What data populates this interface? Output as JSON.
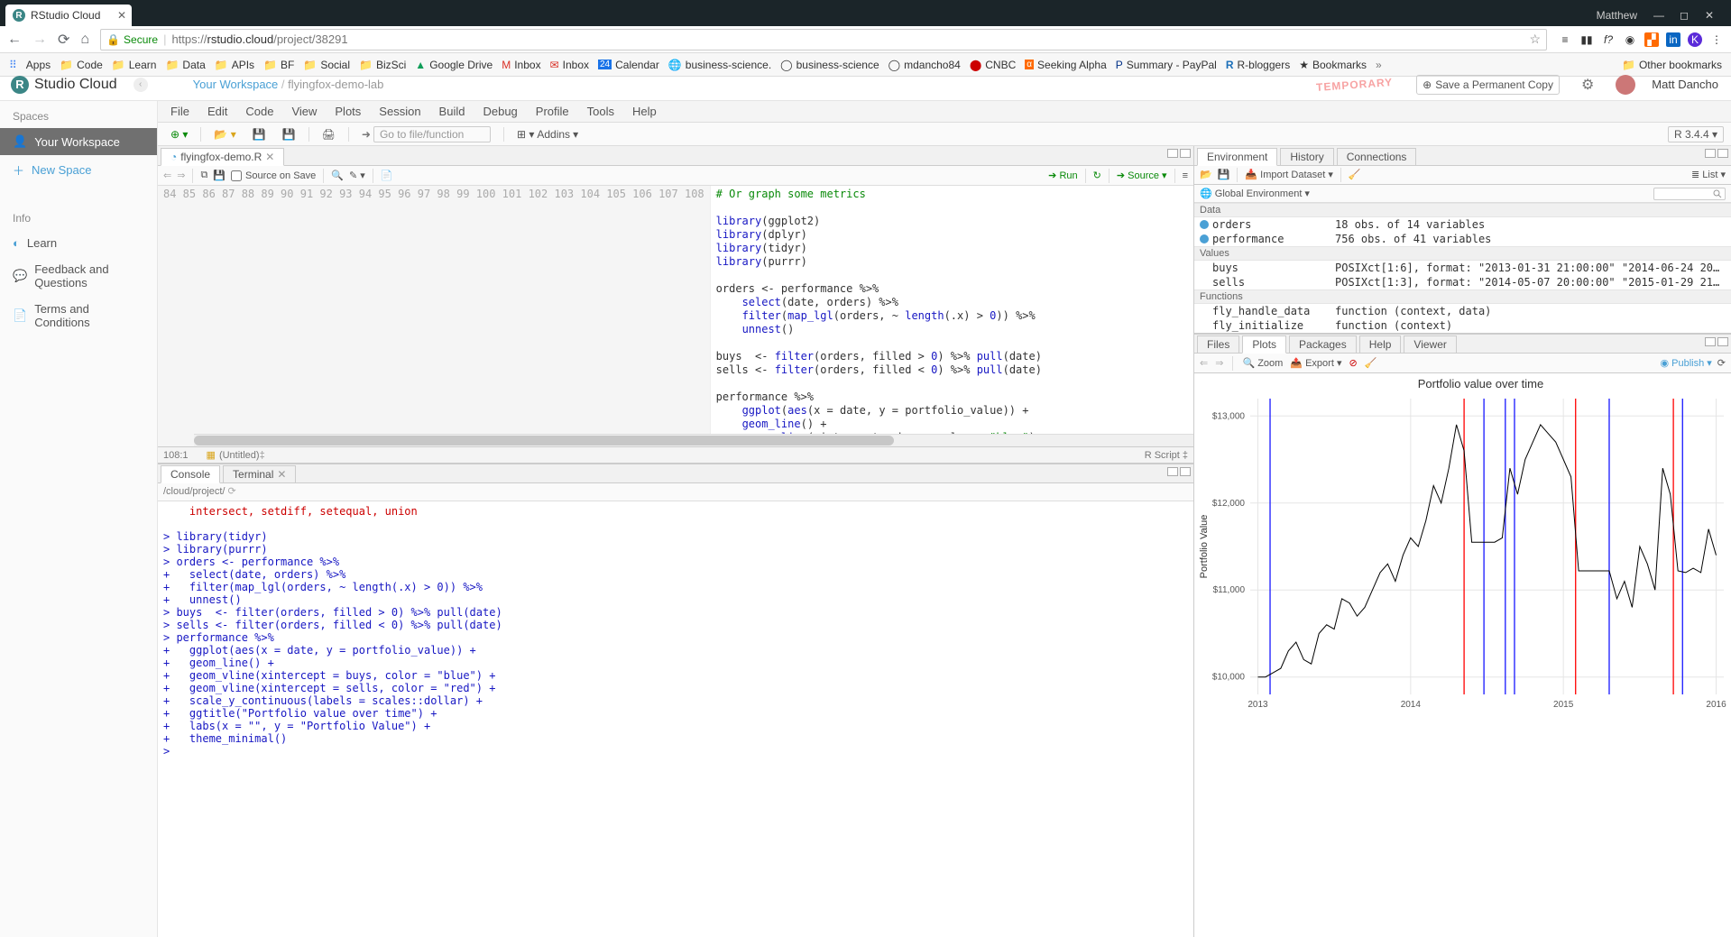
{
  "browser": {
    "tab_title": "RStudio Cloud",
    "user": "Matthew",
    "secure_label": "Secure",
    "url_display": "https://rstudio.cloud/project/38291",
    "bookmarks": [
      "Apps",
      "Code",
      "Learn",
      "Data",
      "APIs",
      "BF",
      "Social",
      "BizSci",
      "Google Drive",
      "Inbox",
      "Inbox",
      "Calendar",
      "business-science.",
      "business-science",
      "mdancho84",
      "CNBC",
      "Seeking Alpha",
      "Summary - PayPal",
      "R-bloggers",
      "Bookmarks"
    ],
    "other_bookmarks": "Other bookmarks"
  },
  "cloud": {
    "logo_text": "Studio Cloud",
    "crumb_workspace": "Your Workspace",
    "crumb_project": "flyingfox-demo-lab",
    "temporary": "TEMPORARY",
    "save_perm": "Save a Permanent Copy",
    "username": "Matt Dancho",
    "sidebar": {
      "spaces": "Spaces",
      "your_workspace": "Your Workspace",
      "new_space": "New Space",
      "info": "Info",
      "learn": "Learn",
      "feedback": "Feedback and Questions",
      "terms": "Terms and Conditions"
    }
  },
  "menus": [
    "File",
    "Edit",
    "Code",
    "View",
    "Plots",
    "Session",
    "Build",
    "Debug",
    "Profile",
    "Tools",
    "Help"
  ],
  "toolbar": {
    "goto_placeholder": "Go to file/function",
    "addins": "Addins",
    "r_version": "R 3.4.4"
  },
  "editor": {
    "tab_name": "flyingfox-demo.R",
    "source_on_save": "Source on Save",
    "run": "Run",
    "source_btn": "Source",
    "start_line": 84,
    "lines": [
      "# Or graph some metrics",
      "",
      "library(ggplot2)",
      "library(dplyr)",
      "library(tidyr)",
      "library(purrr)",
      "",
      "orders <- performance %>%",
      "    select(date, orders) %>%",
      "    filter(map_lgl(orders, ~ length(.x) > 0)) %>%",
      "    unnest()",
      "",
      "buys  <- filter(orders, filled > 0) %>% pull(date)",
      "sells <- filter(orders, filled < 0) %>% pull(date)",
      "",
      "performance %>%",
      "    ggplot(aes(x = date, y = portfolio_value)) +",
      "    geom_line() +",
      "    geom_vline(xintercept = buys, color = \"blue\") +",
      "    geom_vline(xintercept = sells, color = \"red\") +",
      "    scale_y_continuous(labels = scales::dollar) +",
      "    ggtitle(\"Portfolio value over time\") +",
      "    labs(x = \"\", y = \"Portfolio Value\") +",
      "    theme_minimal()",
      ""
    ],
    "status_pos": "108:1",
    "status_scope": "(Untitled)",
    "status_type": "R Script"
  },
  "console": {
    "tab_console": "Console",
    "tab_terminal": "Terminal",
    "path": "/cloud/project/",
    "error_line": "    intersect, setdiff, setequal, union",
    "lines": [
      "> library(tidyr)",
      "> library(purrr)",
      "> orders <- performance %>%",
      "+   select(date, orders) %>%",
      "+   filter(map_lgl(orders, ~ length(.x) > 0)) %>%",
      "+   unnest()",
      "> buys  <- filter(orders, filled > 0) %>% pull(date)",
      "> sells <- filter(orders, filled < 0) %>% pull(date)",
      "> performance %>%",
      "+   ggplot(aes(x = date, y = portfolio_value)) +",
      "+   geom_line() +",
      "+   geom_vline(xintercept = buys, color = \"blue\") +",
      "+   geom_vline(xintercept = sells, color = \"red\") +",
      "+   scale_y_continuous(labels = scales::dollar) +",
      "+   ggtitle(\"Portfolio value over time\") +",
      "+   labs(x = \"\", y = \"Portfolio Value\") +",
      "+   theme_minimal()",
      "> "
    ]
  },
  "env": {
    "tabs": [
      "Environment",
      "History",
      "Connections"
    ],
    "import": "Import Dataset",
    "scope": "Global Environment",
    "list": "List",
    "sections": {
      "data": "Data",
      "values": "Values",
      "functions": "Functions"
    },
    "rows": [
      {
        "sec": "data",
        "name": "orders",
        "val": "18 obs. of 14 variables",
        "exp": true
      },
      {
        "sec": "data",
        "name": "performance",
        "val": "756 obs. of 41 variables",
        "exp": true
      },
      {
        "sec": "values",
        "name": "buys",
        "val": "POSIXct[1:6], format: \"2013-01-31 21:00:00\" \"2014-06-24 20:00:00\" \"2…"
      },
      {
        "sec": "values",
        "name": "sells",
        "val": "POSIXct[1:3], format: \"2014-05-07 20:00:00\" \"2015-01-29 21:00:00\" \"2…"
      },
      {
        "sec": "functions",
        "name": "fly_handle_data",
        "val": "function (context, data)"
      },
      {
        "sec": "functions",
        "name": "fly_initialize",
        "val": "function (context)"
      }
    ]
  },
  "files": {
    "tabs": [
      "Files",
      "Plots",
      "Packages",
      "Help",
      "Viewer"
    ],
    "active": "Plots",
    "zoom": "Zoom",
    "export": "Export",
    "publish": "Publish"
  },
  "chart_data": {
    "type": "line",
    "title": "Portfolio value over time",
    "xlabel": "",
    "ylabel": "Portfolio Value",
    "x_ticks": [
      "2013",
      "2014",
      "2015",
      "2016"
    ],
    "y_ticks": [
      "$10,000",
      "$11,000",
      "$12,000",
      "$13,000"
    ],
    "xlim": [
      2012.95,
      2016.05
    ],
    "ylim": [
      9800,
      13200
    ],
    "vlines_buys": [
      2013.08,
      2014.48,
      2014.62,
      2014.68,
      2015.3,
      2015.78
    ],
    "vlines_sells": [
      2014.35,
      2015.08,
      2015.72
    ],
    "series": [
      {
        "name": "portfolio_value",
        "x": [
          2013.0,
          2013.05,
          2013.1,
          2013.15,
          2013.2,
          2013.25,
          2013.3,
          2013.35,
          2013.4,
          2013.45,
          2013.5,
          2013.55,
          2013.6,
          2013.65,
          2013.7,
          2013.75,
          2013.8,
          2013.85,
          2013.9,
          2013.95,
          2014.0,
          2014.05,
          2014.1,
          2014.15,
          2014.2,
          2014.25,
          2014.3,
          2014.35,
          2014.4,
          2014.45,
          2014.5,
          2014.55,
          2014.6,
          2014.65,
          2014.7,
          2014.75,
          2014.8,
          2014.85,
          2014.9,
          2014.95,
          2015.0,
          2015.05,
          2015.1,
          2015.15,
          2015.2,
          2015.25,
          2015.3,
          2015.35,
          2015.4,
          2015.45,
          2015.5,
          2015.55,
          2015.6,
          2015.65,
          2015.7,
          2015.75,
          2015.8,
          2015.85,
          2015.9,
          2015.95,
          2016.0
        ],
        "y": [
          10000,
          10000,
          10050,
          10100,
          10300,
          10400,
          10200,
          10150,
          10500,
          10600,
          10550,
          10900,
          10850,
          10700,
          10800,
          11000,
          11200,
          11300,
          11100,
          11400,
          11600,
          11500,
          11800,
          12200,
          12000,
          12400,
          12900,
          12600,
          11550,
          11550,
          11550,
          11550,
          11600,
          12400,
          12100,
          12500,
          12700,
          12900,
          12800,
          12700,
          12500,
          12300,
          11220,
          11220,
          11220,
          11220,
          11220,
          10900,
          11100,
          10800,
          11500,
          11300,
          11000,
          12400,
          12100,
          11220,
          11200,
          11250,
          11200,
          11700,
          11400
        ]
      }
    ]
  }
}
